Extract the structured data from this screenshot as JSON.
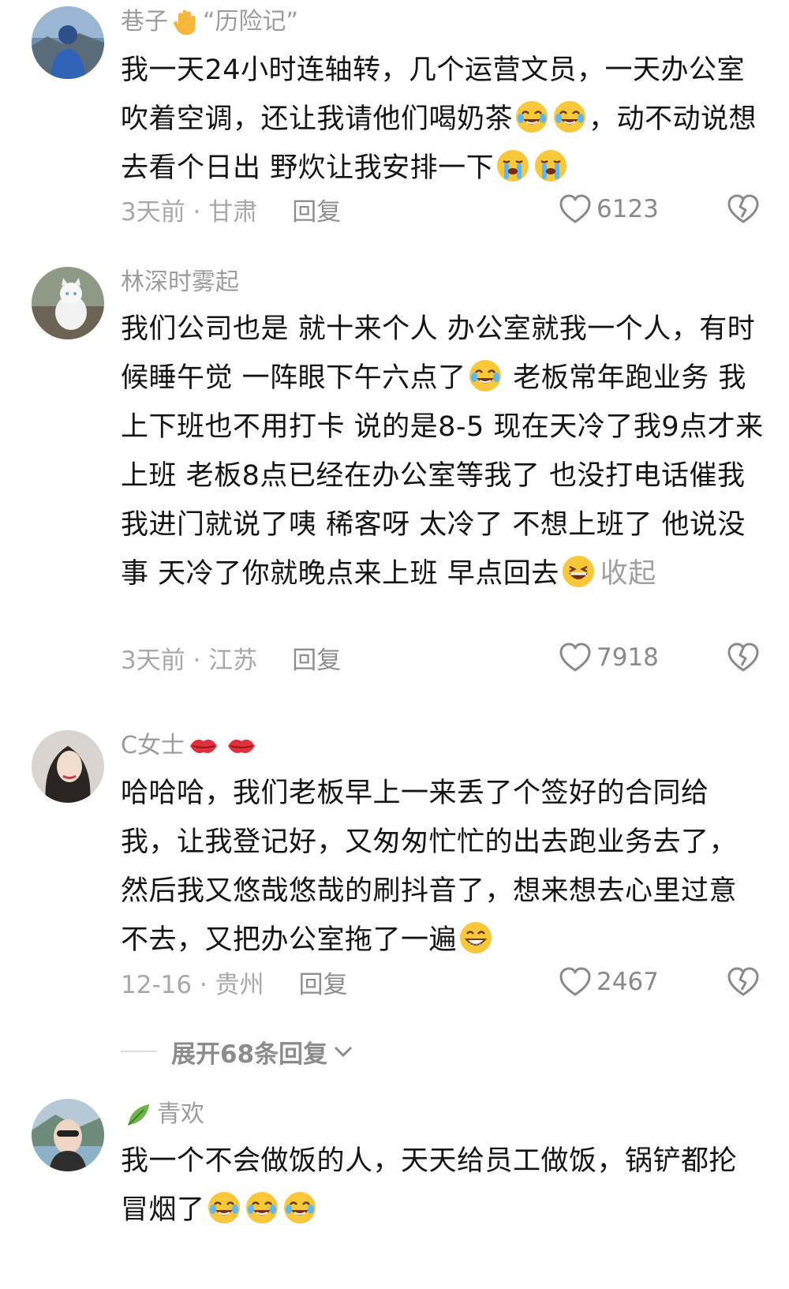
{
  "comments": [
    {
      "username": "巷子",
      "username_suffix": "“历险记”",
      "body_parts": [
        "我一天24小时连轴转，几个运营文员，一天办公室吹着空调，还让我请他们喝奶茶",
        "，动不动说想去看个日出  野炊让我安排一下"
      ],
      "time_location": "3天前 · 甘肃",
      "reply_label": "回复",
      "likes": "6123"
    },
    {
      "username": "林深时雾起",
      "body_parts": [
        "我们公司也是  就十来个人  办公室就我一个人，有时候睡午觉  一阵眼下午六点了",
        "   老板常年跑业务  我上下班也不用打卡  说的是8-5  现在天冷了我9点才来上班  老板8点已经在办公室等我了  也没打电话催我  我进门就说了咦  稀客呀  太冷了  不想上班了  他说没事  天冷了你就晚点来上班  早点回去"
      ],
      "collapse_label": "收起",
      "time_location": "3天前 · 江苏",
      "reply_label": "回复",
      "likes": "7918"
    },
    {
      "username": "C女士",
      "body_parts": [
        "哈哈哈，我们老板早上一来丢了个签好的合同给我，让我登记好，又匆匆忙忙的出去跑业务去了，然后我又悠哉悠哉的刷抖音了，想来想去心里过意不去，又把办公室拖了一遍"
      ],
      "time_location": "12-16 · 贵州",
      "reply_label": "回复",
      "likes": "2467"
    },
    {
      "username": "青欢",
      "body_parts": [
        "我一个不会做饭的人，天天给员工做饭，锅铲都抡冒烟了"
      ]
    }
  ],
  "expand_replies_label": "展开68条回复",
  "icons": {
    "like": "heart-outline-icon",
    "dislike": "broken-heart-icon",
    "expand": "chevron-down-icon"
  },
  "colors": {
    "meta_text": "#a8a8a8",
    "username": "#9c9c9c",
    "emoji_face": "#f8c73a"
  }
}
